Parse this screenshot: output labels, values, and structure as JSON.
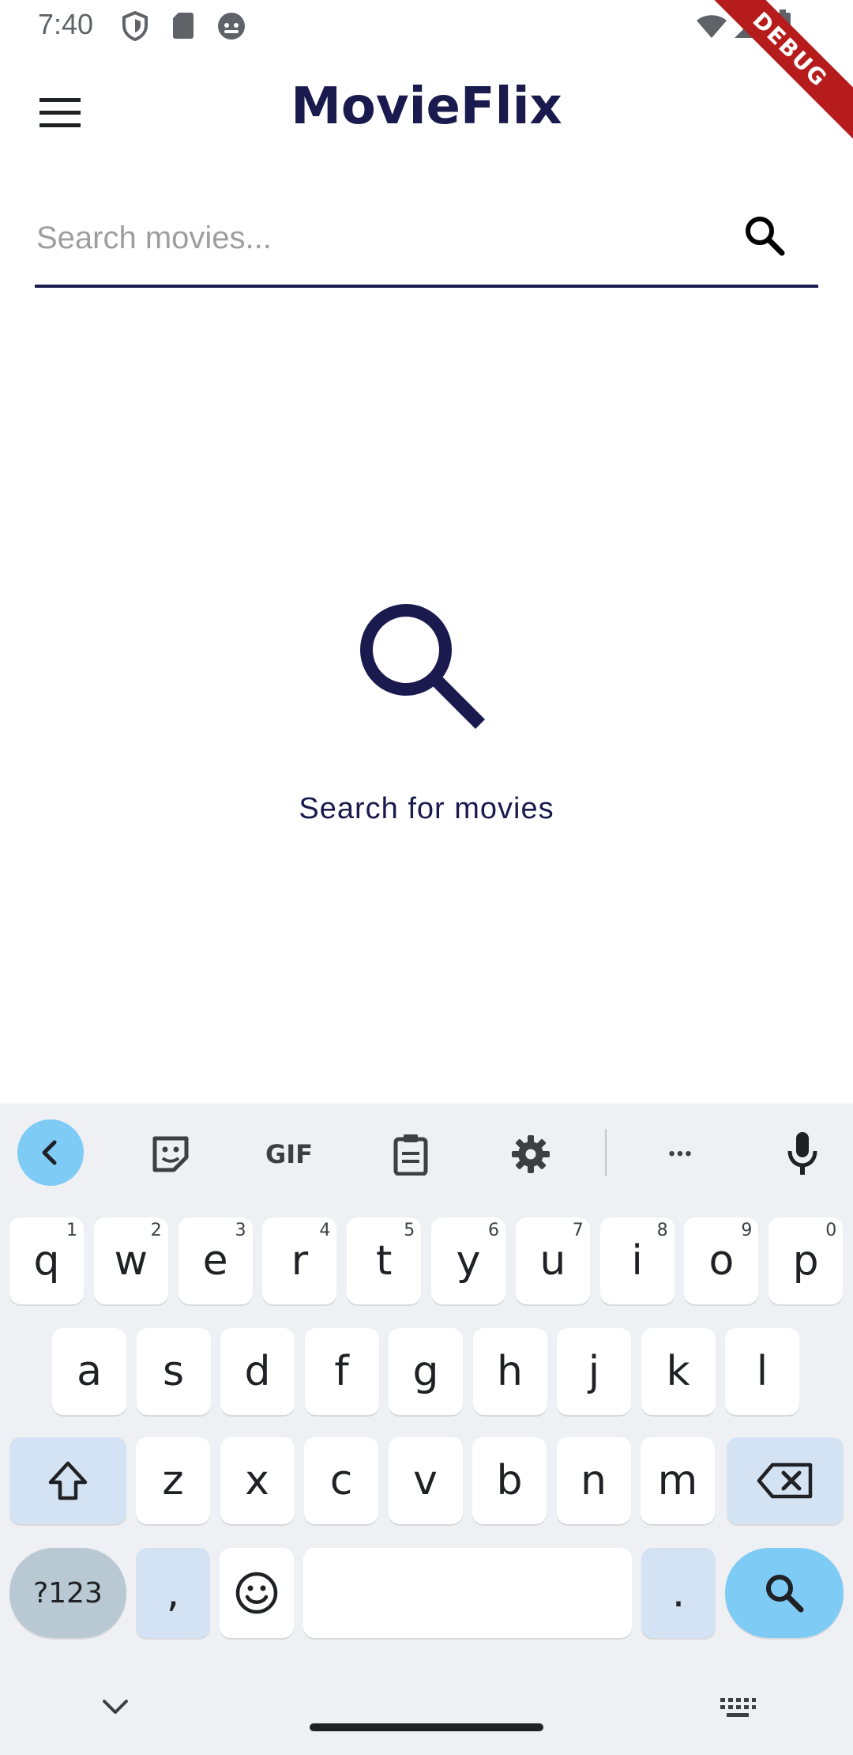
{
  "status_bar": {
    "time": "7:40",
    "debug_label": "DEBUG"
  },
  "app_bar": {
    "title": "MovieFlix"
  },
  "search": {
    "placeholder": "Search movies...",
    "value": ""
  },
  "empty_state": {
    "message": "Search for movies"
  },
  "keyboard": {
    "toolbar": {
      "gif_label": "GIF",
      "more_label": "•••"
    },
    "row1": [
      {
        "key": "q",
        "hint": "1"
      },
      {
        "key": "w",
        "hint": "2"
      },
      {
        "key": "e",
        "hint": "3"
      },
      {
        "key": "r",
        "hint": "4"
      },
      {
        "key": "t",
        "hint": "5"
      },
      {
        "key": "y",
        "hint": "6"
      },
      {
        "key": "u",
        "hint": "7"
      },
      {
        "key": "i",
        "hint": "8"
      },
      {
        "key": "o",
        "hint": "9"
      },
      {
        "key": "p",
        "hint": "0"
      }
    ],
    "row2": [
      "a",
      "s",
      "d",
      "f",
      "g",
      "h",
      "j",
      "k",
      "l"
    ],
    "row3": [
      "z",
      "x",
      "c",
      "v",
      "b",
      "n",
      "m"
    ],
    "bottom": {
      "symbols_label": "?123",
      "comma": ",",
      "period": "."
    }
  },
  "colors": {
    "accent": "#1a1a4e",
    "keyboard_action": "#7ecbf6",
    "debug": "#b71c1c"
  }
}
